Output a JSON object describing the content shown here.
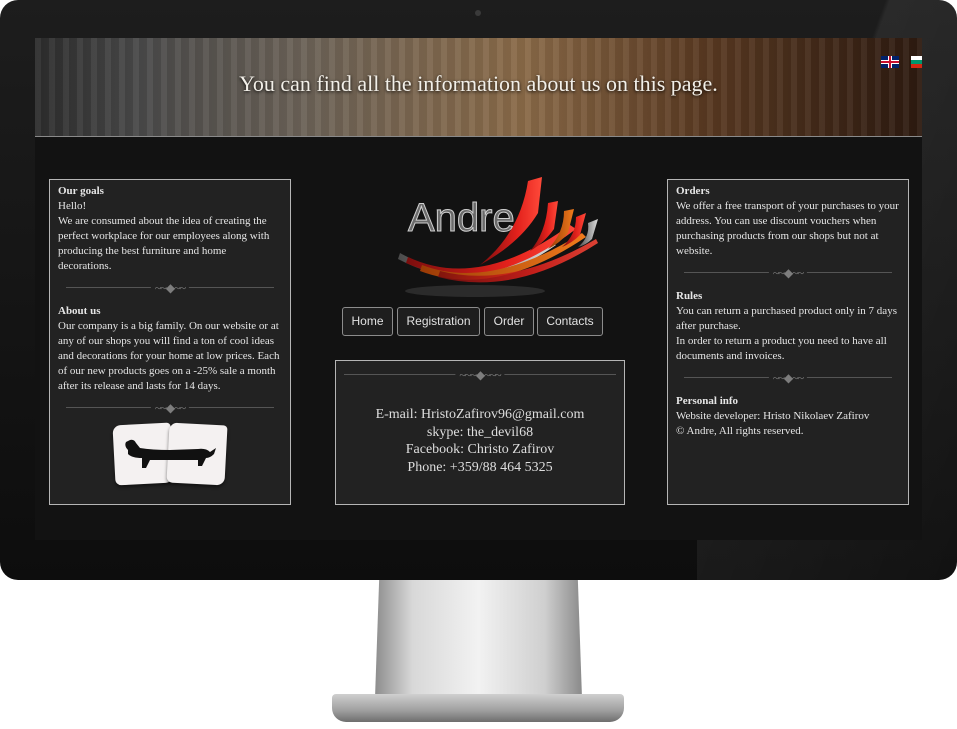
{
  "header": {
    "title": "You can find all the information about us on this page.",
    "flags": [
      "uk-flag-icon",
      "bulgaria-flag-icon"
    ]
  },
  "logo": {
    "text": "Andre"
  },
  "nav": {
    "items": [
      "Home",
      "Registration",
      "Order",
      "Contacts"
    ]
  },
  "left_panel": {
    "goals_title": "Our goals",
    "goals_line1": "Hello!",
    "goals_text": "We are consumed about the idea of creating the perfect workplace for our employees along with producing the best furniture and home decorations.",
    "about_title": "About us",
    "about_text": "Our company is a big family. On our website or at any of our shops you will find a ton of cool ideas and decorations for your home at low prices. Each of our new products goes on a -25% sale a month after its release and lasts for 14 days."
  },
  "contact": {
    "email": "E-mail: HristoZafirov96@gmail.com",
    "skype": "skype: the_devil68",
    "facebook": "Facebook: Christo Zafirov",
    "phone": "Phone: +359/88 464 5325"
  },
  "right_panel": {
    "orders_title": "Orders",
    "orders_text": "We offer a free transport of your purchases to your address. You can use discount vouchers when purchasing products from our shops but not at website.",
    "rules_title": "Rules",
    "rules_line1": "You can return a purchased product only in 7 days after purchase.",
    "rules_line2": "In order to return a product you need to have all documents and invoices.",
    "personal_title": "Personal info",
    "personal_line1": "Website developer: Hristo Nikolaev Zafirov",
    "personal_line2": "© Andre, All rights reserved."
  },
  "colors": {
    "panel_bg": "#222222",
    "panel_border": "#b5b5b5",
    "logo_red": "#e3211c",
    "logo_orange": "#f07b1c"
  }
}
